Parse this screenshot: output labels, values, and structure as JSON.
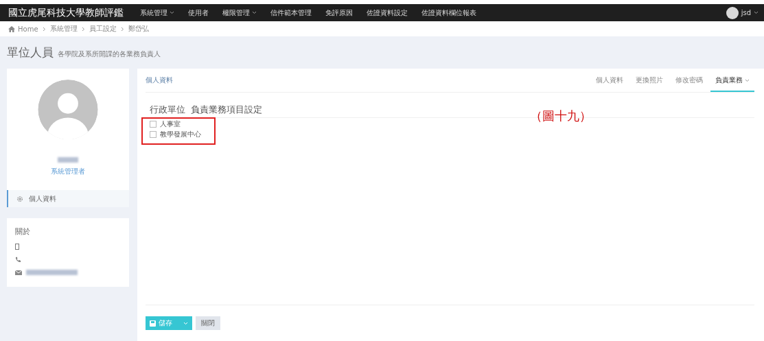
{
  "app_title": "國立虎尾科技大學教師評鑑",
  "nav": [
    {
      "label": "系統管理",
      "dropdown": true
    },
    {
      "label": "使用者",
      "dropdown": false
    },
    {
      "label": "權限管理",
      "dropdown": true
    },
    {
      "label": "信件範本管理",
      "dropdown": false
    },
    {
      "label": "免評原因",
      "dropdown": false
    },
    {
      "label": "佐證資料設定",
      "dropdown": false
    },
    {
      "label": "佐證資料欄位報表",
      "dropdown": false
    }
  ],
  "user": {
    "name": "jsd"
  },
  "breadcrumb": [
    {
      "label": "Home",
      "kind": "home"
    },
    {
      "label": "系統管理",
      "kind": "crumb"
    },
    {
      "label": "員工設定",
      "kind": "crumb"
    },
    {
      "label": "鄭岱弘",
      "kind": "crumb"
    }
  ],
  "page_header": {
    "title": "單位人員",
    "subtitle": "各學院及系所開課的各業務負責人"
  },
  "profile": {
    "role": "系統管理者",
    "menu": [
      {
        "label": "個人資料",
        "selected": true
      }
    ]
  },
  "about": {
    "title": "關於"
  },
  "panel": {
    "title": "個人資料",
    "tabs": [
      {
        "label": "個人資料",
        "selected": false,
        "dropdown": false
      },
      {
        "label": "更換照片",
        "selected": false,
        "dropdown": false
      },
      {
        "label": "修改密碼",
        "selected": false,
        "dropdown": false
      },
      {
        "label": "負責業務",
        "selected": true,
        "dropdown": true
      }
    ],
    "section_title": "行政單位  負責業務項目設定",
    "options": [
      {
        "label": "人事室",
        "checked": false
      },
      {
        "label": "教學發展中心",
        "checked": false
      }
    ],
    "annotation": "（圖十九）"
  },
  "actions": {
    "save": "儲存",
    "close": "關閉"
  }
}
